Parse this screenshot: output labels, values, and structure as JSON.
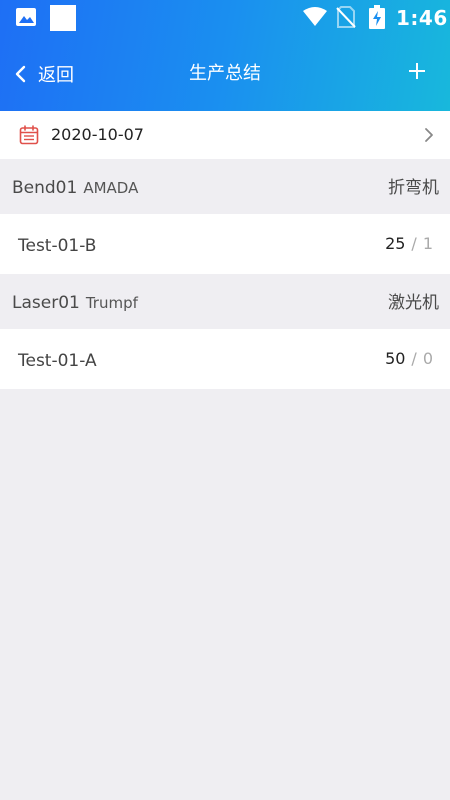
{
  "status_bar": {
    "time": "1:46",
    "icons": [
      "image-icon",
      "white-square-icon",
      "wifi-icon",
      "no-sim-icon",
      "battery-charging-icon"
    ]
  },
  "navbar": {
    "back_label": "返回",
    "title": "生产总结",
    "add_icon": "plus-icon"
  },
  "date_row": {
    "date": "2020-10-07",
    "icon": "calendar-icon",
    "accent": "#e0504a"
  },
  "machines": [
    {
      "name": "Bend01",
      "brand": "AMADA",
      "type": "折弯机",
      "items": [
        {
          "name": "Test-01-B",
          "done": "25",
          "separator": "/",
          "total": "1"
        }
      ]
    },
    {
      "name": "Laser01",
      "brand": "Trumpf",
      "type": "激光机",
      "items": [
        {
          "name": "Test-01-A",
          "done": "50",
          "separator": "/",
          "total": "0"
        }
      ]
    }
  ],
  "colors": {
    "header_start": "#1e6ff5",
    "header_end": "#18b8dc",
    "background": "#efeef2"
  }
}
